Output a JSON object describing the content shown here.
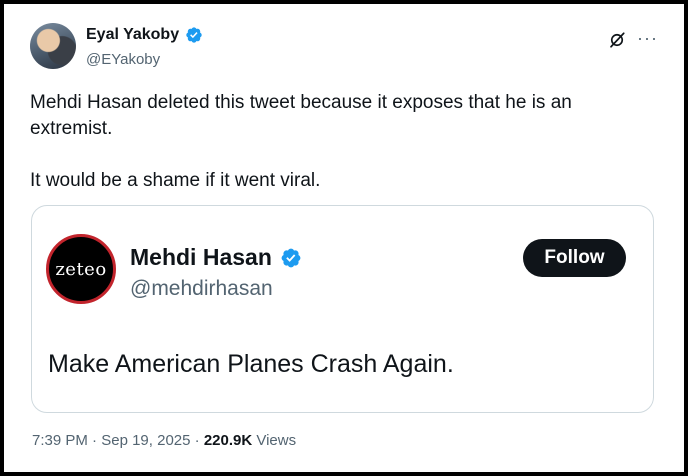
{
  "tweet": {
    "author": {
      "display_name": "Eyal Yakoby",
      "handle": "@EYakoby",
      "verified_icon": "verified-badge-icon",
      "verified_color": "#1d9bf0"
    },
    "text_paragraphs": [
      "Mehdi Hasan deleted this tweet because it exposes that he is an extremist.",
      "It would be a shame if it went viral."
    ],
    "header_icons": [
      "grok-icon",
      "more-options-icon"
    ],
    "meta": {
      "time": "7:39 PM",
      "separator": "·",
      "date": "Sep 19, 2025",
      "views_count": "220.9K",
      "views_label": "Views"
    }
  },
  "quoted_tweet": {
    "avatar_text": "zeteo",
    "avatar_ring_color": "#c2242c",
    "display_name": "Mehdi Hasan",
    "handle": "@mehdirhasan",
    "follow_label": "Follow",
    "text": "Make American Planes Crash Again."
  }
}
